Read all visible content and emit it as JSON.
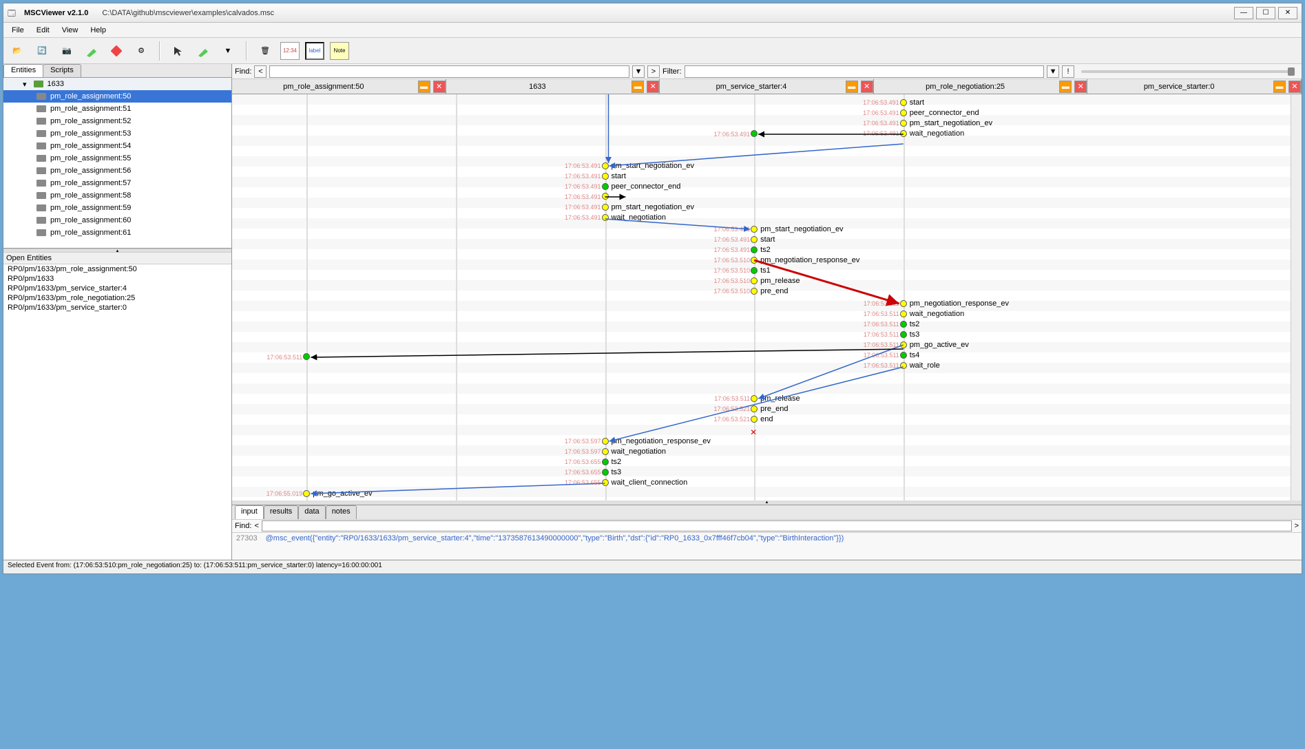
{
  "app": {
    "name": "MSCViewer v2.1.0",
    "file": "C:\\DATA\\github\\mscviewer\\examples\\calvados.msc"
  },
  "menu": {
    "file": "File",
    "edit": "Edit",
    "view": "View",
    "help": "Help"
  },
  "left_tabs": {
    "entities": "Entities",
    "scripts": "Scripts"
  },
  "tree": {
    "parent": "1633",
    "items": [
      "pm_role_assignment:50",
      "pm_role_assignment:51",
      "pm_role_assignment:52",
      "pm_role_assignment:53",
      "pm_role_assignment:54",
      "pm_role_assignment:55",
      "pm_role_assignment:56",
      "pm_role_assignment:57",
      "pm_role_assignment:58",
      "pm_role_assignment:59",
      "pm_role_assignment:60",
      "pm_role_assignment:61"
    ],
    "selected": 0
  },
  "open_entities": {
    "header": "Open Entities",
    "items": [
      "RP0/pm/1633/pm_role_assignment:50",
      "RP0/pm/1633",
      "RP0/pm/1633/pm_service_starter:4",
      "RP0/pm/1633/pm_role_negotiation:25",
      "RP0/pm/1633/pm_service_starter:0"
    ]
  },
  "findbar": {
    "find_label": "Find:",
    "filter_label": "Filter:"
  },
  "columns": [
    {
      "label": "pm_role_assignment:50"
    },
    {
      "label": "1633"
    },
    {
      "label": "pm_service_starter:4"
    },
    {
      "label": "pm_role_negotiation:25"
    },
    {
      "label": "pm_service_starter:0"
    }
  ],
  "timestamps_common": "17:06:53.491",
  "events": {
    "col4_top": [
      {
        "ts": "17:06:53.491",
        "c": "y",
        "label": "start"
      },
      {
        "ts": "17:06:53.491",
        "c": "y",
        "label": "peer_connector_end"
      },
      {
        "ts": "17:06:53.491",
        "c": "y",
        "label": "pm_start_negotiation_ev"
      },
      {
        "ts": "17:06:53.491",
        "c": "y",
        "label": "wait_negotiation"
      }
    ],
    "col2": [
      {
        "ts": "17:06:53.491",
        "c": "y",
        "label": "pm_start_negotiation_ev"
      },
      {
        "ts": "17:06:53.491",
        "c": "y",
        "label": "start"
      },
      {
        "ts": "17:06:53.491",
        "c": "g",
        "label": "peer_connector_end"
      },
      {
        "ts": "17:06:53.491",
        "c": "y",
        "label": ""
      },
      {
        "ts": "17:06:53.491",
        "c": "y",
        "label": "pm_start_negotiation_ev"
      },
      {
        "ts": "17:06:53.491",
        "c": "y",
        "label": "wait_negotiation"
      }
    ],
    "col3_mid": [
      {
        "ts": "17:06:53.491",
        "c": "y",
        "label": "pm_start_negotiation_ev"
      },
      {
        "ts": "17:06:53.491",
        "c": "y",
        "label": "start"
      },
      {
        "ts": "17:06:53.491",
        "c": "g",
        "label": "ts2"
      },
      {
        "ts": "17:06:53.510",
        "c": "y",
        "label": "pm_negotiation_response_ev"
      },
      {
        "ts": "17:06:53.510",
        "c": "g",
        "label": "ts1"
      },
      {
        "ts": "17:06:53.510",
        "c": "y",
        "label": "pm_release"
      },
      {
        "ts": "17:06:53.510",
        "c": "y",
        "label": "pre_end"
      }
    ],
    "col4_mid": [
      {
        "ts": "17:06:53.511",
        "c": "y",
        "label": "pm_negotiation_response_ev"
      },
      {
        "ts": "17:06:53.511",
        "c": "y",
        "label": "wait_negotiation"
      },
      {
        "ts": "17:06:53.511",
        "c": "g",
        "label": "ts2"
      },
      {
        "ts": "17:06:53.511",
        "c": "g",
        "label": "ts3"
      },
      {
        "ts": "17:06:53.511",
        "c": "y",
        "label": "pm_go_active_ev"
      },
      {
        "ts": "17:06:53.511",
        "c": "g",
        "label": "ts4"
      },
      {
        "ts": "17:06:53.511",
        "c": "y",
        "label": "wait_role"
      }
    ],
    "col3_bot": [
      {
        "ts": "17:06:53.511",
        "c": "y",
        "label": "pm_release"
      },
      {
        "ts": "17:06:53.521",
        "c": "y",
        "label": "pre_end"
      },
      {
        "ts": "17:06:53.521",
        "c": "y",
        "label": "end"
      }
    ],
    "col2_bot": [
      {
        "ts": "17:06:53.597",
        "c": "y",
        "label": "pm_negotiation_response_ev"
      },
      {
        "ts": "17:06:53.597",
        "c": "y",
        "label": "wait_negotiation"
      },
      {
        "ts": "17:06:53.655",
        "c": "g",
        "label": "ts2"
      },
      {
        "ts": "17:06:53.655",
        "c": "g",
        "label": "ts3"
      },
      {
        "ts": "17:06:53.655",
        "c": "y",
        "label": "wait_client_connection"
      }
    ],
    "col0": [
      {
        "ts": "17:06:53.511",
        "c": "g",
        "label": ""
      },
      {
        "ts": "17:06:55.019",
        "c": "y",
        "label": "pm_go_active_ev"
      }
    ]
  },
  "bottom_tabs": {
    "input": "input",
    "results": "results",
    "data": "data",
    "notes": "notes"
  },
  "bottom": {
    "find": "Find:",
    "line_no": "27303",
    "text": "@msc_event({\"entity\":\"RP0/1633/1633/pm_service_starter:4\",\"time\":\"1373587613490000000\",\"type\":\"Birth\",\"dst\":{\"id\":\"RP0_1633_0x7fff46f7cb04\",\"type\":\"BirthInteraction\"}})"
  },
  "status": "Selected Event from: (17:06:53:510:pm_role_negotiation:25) to: (17:06:53:511:pm_service_starter:0) latency=16:00:00:001"
}
